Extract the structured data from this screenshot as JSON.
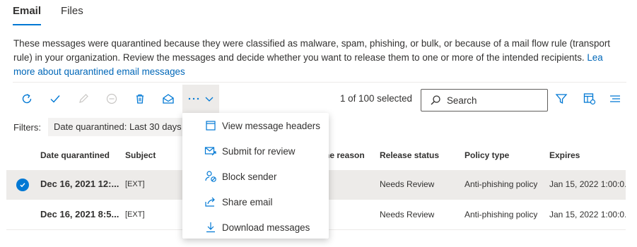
{
  "tabs": [
    {
      "label": "Email",
      "active": true
    },
    {
      "label": "Files",
      "active": false
    }
  ],
  "description": {
    "line1": "These messages were quarantined because they were classified as malware, spam, phishing, or bulk, or because of a mail flow rule (transport",
    "line2_text": "rule) in your organization. Review the messages and decide whether you want to release them to one or more of the intended recipients. ",
    "line2_link": "Lea",
    "line3_link": "more about quarantined email messages"
  },
  "toolbar": {
    "icons": [
      "refresh-icon",
      "checkmark-icon",
      "edit-icon",
      "block-icon",
      "delete-icon",
      "open-envelope-icon",
      "more-icon",
      "chevron-down-icon",
      "filter-icon",
      "customize-columns-icon",
      "group-icon"
    ],
    "selected_count": "1 of 100 selected",
    "search_placeholder": "Search"
  },
  "filters": {
    "label": "Filters:",
    "pill": "Date quarantined: Last 30 days"
  },
  "table": {
    "columns": [
      "Date quarantined",
      "Subject",
      "ne reason",
      "Release status",
      "Policy type",
      "Expires"
    ],
    "rows": [
      {
        "selected": true,
        "date": "Dec 16, 2021 12:...",
        "subject": "[EXT]",
        "release_status": "Needs Review",
        "policy_type": "Anti-phishing policy",
        "expires": "Jan 15, 2022 1:00:0..."
      },
      {
        "selected": false,
        "date": "Dec 16, 2021 8:5...",
        "subject": "[EXT]",
        "release_status": "Needs Review",
        "policy_type": "Anti-phishing policy",
        "expires": "Jan 15, 2022 1:00:0..."
      }
    ]
  },
  "menu": {
    "items": [
      {
        "label": "View message headers",
        "icon": "message-header-icon"
      },
      {
        "label": "Submit for review",
        "icon": "submit-mail-icon"
      },
      {
        "label": "Block sender",
        "icon": "block-contact-icon"
      },
      {
        "label": "Share email",
        "icon": "share-icon"
      },
      {
        "label": "Download messages",
        "icon": "download-icon"
      }
    ]
  },
  "colors": {
    "accent": "#0078d4",
    "link": "#0067b8",
    "text": "#323130",
    "selected_row": "#edebe9"
  }
}
